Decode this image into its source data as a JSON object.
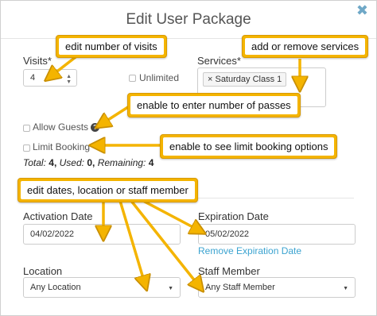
{
  "modal": {
    "title": "Edit User Package",
    "close_icon": "✖"
  },
  "visits": {
    "label": "Visits*",
    "value": "4"
  },
  "unlimited": {
    "label": "Unlimited",
    "checked": false
  },
  "services": {
    "label": "Services*",
    "tags": [
      "× Saturday Class 1"
    ]
  },
  "allow_guests": {
    "label": "Allow Guests",
    "help_icon": "?",
    "checked": false
  },
  "limit_booking": {
    "label": "Limit Booking",
    "checked": false
  },
  "totals": {
    "total_label": "Total:",
    "total_value": "4,",
    "used_label": "Used:",
    "used_value": "0,",
    "remaining_label": "Remaining:",
    "remaining_value": "4"
  },
  "activation_date": {
    "label": "Activation Date",
    "value": "04/02/2022"
  },
  "expiration_date": {
    "label": "Expiration Date",
    "value": "05/02/2022",
    "remove_link": "Remove Expiration Date"
  },
  "location": {
    "label": "Location",
    "value": "Any Location"
  },
  "staff_member": {
    "label": "Staff Member",
    "value": "Any Staff Member"
  },
  "callouts": {
    "edit_visits": "edit number of visits",
    "services": "add or remove services",
    "guests": "enable to enter number of passes",
    "limit_booking": "enable to see limit booking options",
    "dates": "edit dates, location or staff member"
  },
  "colors": {
    "callout_border": "#f4b400",
    "link": "#3ba3d0",
    "close_icon": "#6fa8c7"
  }
}
